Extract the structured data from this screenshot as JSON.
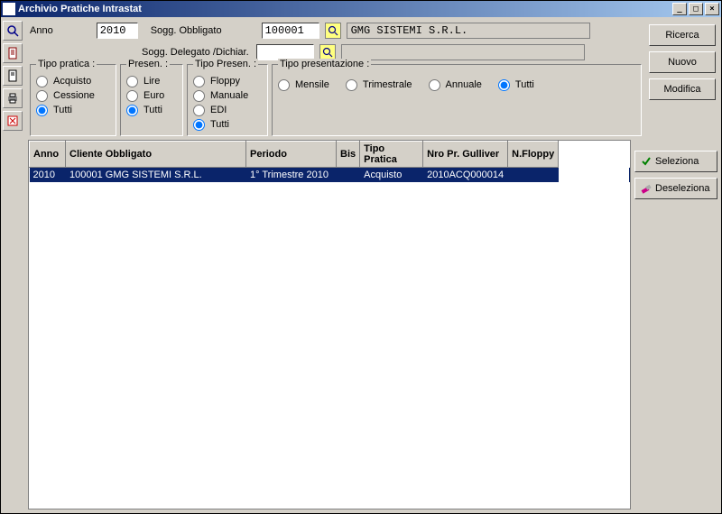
{
  "window": {
    "title": "Archivio Pratiche Intrastat"
  },
  "filters": {
    "anno_label": "Anno",
    "anno_value": "2010",
    "sogg_obbl_label": "Sogg. Obbligato",
    "sogg_obbl_value": "100001",
    "sogg_obbl_name": "GMG SISTEMI S.R.L.",
    "sogg_deleg_label": "Sogg. Delegato /Dichiar.",
    "sogg_deleg_value": "",
    "sogg_deleg_name": ""
  },
  "groups": {
    "tipo_pratica": {
      "title": "Tipo pratica :",
      "options": [
        "Acquisto",
        "Cessione",
        "Tutti"
      ],
      "selected": "Tutti"
    },
    "presen": {
      "title": "Presen. :",
      "options": [
        "Lire",
        "Euro",
        "Tutti"
      ],
      "selected": "Tutti"
    },
    "tipo_presen": {
      "title": "Tipo Presen. :",
      "options": [
        "Floppy",
        "Manuale",
        "EDI",
        "Tutti"
      ],
      "selected": "Tutti"
    },
    "tipo_presentazione": {
      "title": "Tipo presentazione :",
      "options": [
        "Mensile",
        "Trimestrale",
        "Annuale",
        "Tutti"
      ],
      "selected": "Tutti"
    }
  },
  "buttons": {
    "ricerca": "Ricerca",
    "nuovo": "Nuovo",
    "modifica": "Modifica",
    "seleziona": "Seleziona",
    "deseleziona": "Deseleziona"
  },
  "grid": {
    "columns": [
      "Anno",
      "Cliente Obbligato",
      "Periodo",
      "Bis",
      "Tipo Pratica",
      "Nro Pr. Gulliver",
      "N.Floppy"
    ],
    "rows": [
      {
        "anno": "2010",
        "cliente": "100001  GMG SISTEMI S.R.L.",
        "periodo": "1° Trimestre  2010",
        "bis": "",
        "tipo": "Acquisto",
        "nro": "2010ACQ000014",
        "nfloppy": ""
      }
    ]
  }
}
